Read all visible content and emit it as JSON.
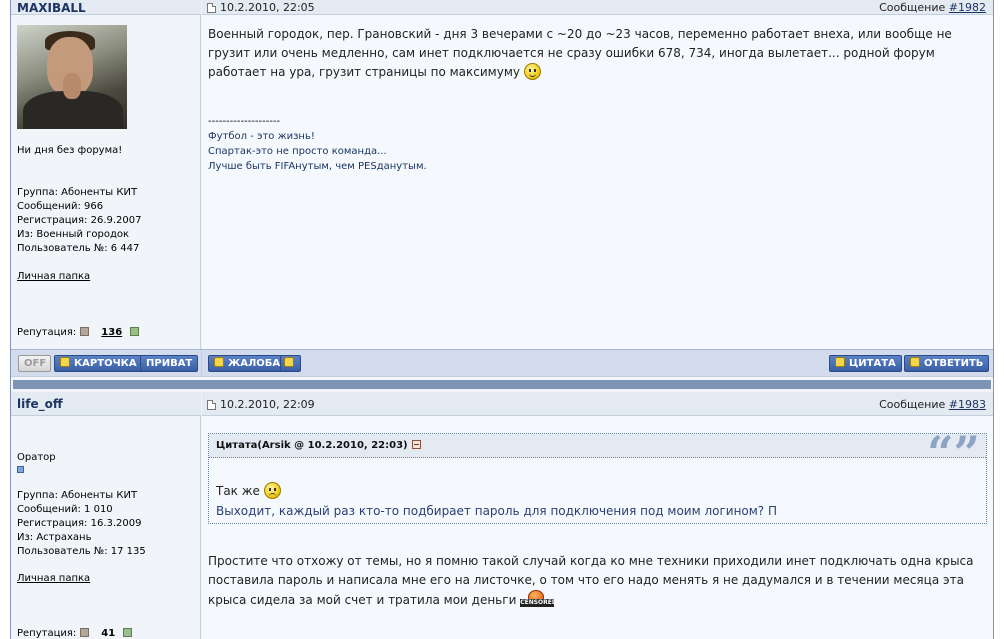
{
  "posts": [
    {
      "username": "MAXIBALL",
      "date": "10.2.2010, 22:05",
      "msg_label": "Сообщение",
      "msg_number": "#1982",
      "status_text": "Ни дня без форума!",
      "info": {
        "group": "Группа: Абоненты КИТ",
        "messages": "Сообщений: 966",
        "registered": "Регистрация: 26.9.2007",
        "from": "Из: Военный городок",
        "user_no": "Пользователь №: 6 447"
      },
      "folder_link": "Личная папка",
      "reputation_label": "Репутация:",
      "reputation_value": "136",
      "body": "Военный городок, пер. Грановский - дня 3 вечерами с ~20 до ~23 часов, переменно работает внеха, или вообще не грузит или очень медленно, сам инет подключается не сразу ошибки 678, 734, иногда вылетает... родной форум работает на ура, грузит страницы по максимуму",
      "signature": {
        "divider": "--------------------",
        "lines": [
          "Футбол - это жизнь!",
          "Спартак-это не просто команда...",
          "Лучше быть FIFAнутым, чем PESданутым."
        ]
      }
    },
    {
      "username": "life_off",
      "date": "10.2.2010, 22:09",
      "msg_label": "Сообщение",
      "msg_number": "#1983",
      "rank": "Оратор",
      "info": {
        "group": "Группа: Абоненты КИТ",
        "messages": "Сообщений: 1 010",
        "registered": "Регистрация: 16.3.2009",
        "from": "Из: Астрахань",
        "user_no": "Пользователь №: 17 135"
      },
      "folder_link": "Личная папка",
      "reputation_label": "Репутация:",
      "reputation_value": "41",
      "quote": {
        "title": "Цитата(Arsik @ 10.2.2010, 22:03)",
        "line1": "Так же",
        "line2": "Выходит, каждый раз кто-то подбирает пароль для подключения под моим логином? П"
      },
      "body": "Простите что отхожу от темы, но я помню такой случай когда ко мне техники приходили инет подключать одна крыса поставила пароль и написала мне его на листочке, о том что его надо менять я не дадумался и в течении месяца эта крыса сидела за мой счет и тратила мои деньги",
      "censored_label": "CENSORED"
    }
  ],
  "buttons": {
    "off": "OFF",
    "card": "КАРТОЧКА",
    "private": "ПРИВАТ",
    "report": "ЖАЛОБА",
    "quote": "ЦИТАТА",
    "reply": "ОТВЕТИТЬ"
  },
  "icons": {
    "date": "post-date-icon",
    "quote_mark": "quote-mark-icon",
    "smile": "smile-icon",
    "sad": "sad-smile-icon",
    "censored": "censored-icon"
  }
}
